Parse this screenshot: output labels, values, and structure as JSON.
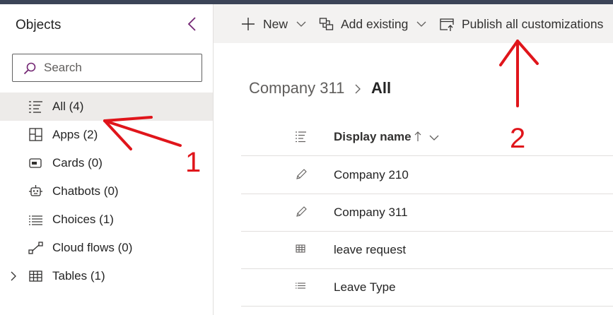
{
  "sidebar": {
    "title": "Objects",
    "collapse_icon": "chevron-left-icon",
    "search": {
      "placeholder": "Search",
      "value": ""
    },
    "items": [
      {
        "label": "All",
        "count": "(4)",
        "icon": "list-icon",
        "selected": true
      },
      {
        "label": "Apps",
        "count": "(2)",
        "icon": "apps-icon"
      },
      {
        "label": "Cards",
        "count": "(0)",
        "icon": "card-icon"
      },
      {
        "label": "Chatbots",
        "count": "(0)",
        "icon": "bot-icon"
      },
      {
        "label": "Choices",
        "count": "(1)",
        "icon": "choices-list-icon"
      },
      {
        "label": "Cloud flows",
        "count": "(0)",
        "icon": "flow-icon"
      },
      {
        "label": "Tables",
        "count": "(1)",
        "icon": "table-icon",
        "expandable": true
      }
    ]
  },
  "toolbar": {
    "new_label": "New",
    "add_existing_label": "Add existing",
    "publish_label": "Publish all customizations"
  },
  "breadcrumb": {
    "parent": "Company 311",
    "current": "All"
  },
  "table": {
    "header": {
      "label": "Display name",
      "sort": "ascending"
    },
    "rows": [
      {
        "name": "Company 210",
        "icon": "pencil-icon"
      },
      {
        "name": "Company 311",
        "icon": "pencil-icon"
      },
      {
        "name": "leave request",
        "icon": "table-icon"
      },
      {
        "name": "Leave Type",
        "icon": "choices-list-icon"
      }
    ]
  },
  "annotations": {
    "one": "1",
    "two": "2",
    "color": "#e0151b"
  },
  "colors": {
    "accent": "#742774",
    "selected_bg": "#edebe9",
    "commandbar_bg": "#f3f2f1",
    "annotation": "#e0151b"
  }
}
